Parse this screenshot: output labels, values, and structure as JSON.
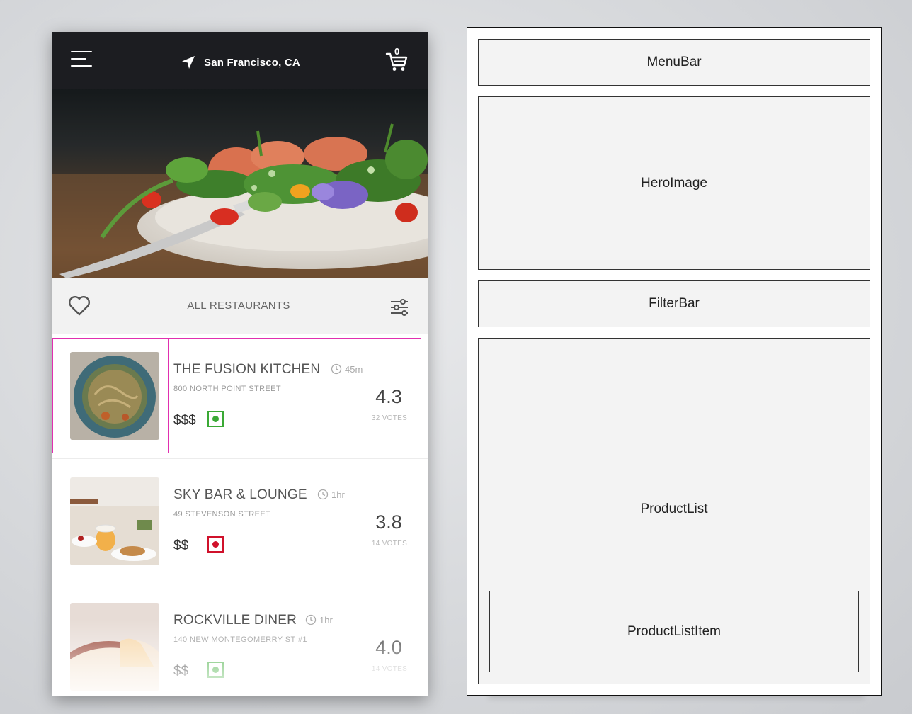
{
  "app": {
    "location": "San Francisco, CA",
    "cart_count": "0"
  },
  "filter_bar": {
    "title": "ALL RESTAURANTS"
  },
  "restaurants": [
    {
      "name": "THE FUSION KITCHEN",
      "time": "45m",
      "address": "800 NORTH POINT STREET",
      "price": "$$$",
      "food_type": "veg",
      "food_type_color": "#3aa935",
      "rating": "4.3",
      "votes": "32 VOTES"
    },
    {
      "name": "SKY BAR & LOUNGE",
      "time": "1hr",
      "address": "49 STEVENSON STREET",
      "price": "$$",
      "food_type": "non-veg",
      "food_type_color": "#d0112b",
      "rating": "3.8",
      "votes": "14 VOTES"
    },
    {
      "name": "ROCKVILLE DINER",
      "time": "1hr",
      "address": "140 NEW MONTEGOMERRY ST #1",
      "price": "$$",
      "food_type": "veg",
      "food_type_color": "#3aa935",
      "rating": "4.0",
      "votes": "14 VOTES"
    }
  ],
  "highlight_color": "#e12fb0",
  "wireframe": {
    "menubar": "MenuBar",
    "hero": "HeroImage",
    "filterbar": "FilterBar",
    "productlist": "ProductList",
    "productlistitem": "ProductListItem"
  }
}
